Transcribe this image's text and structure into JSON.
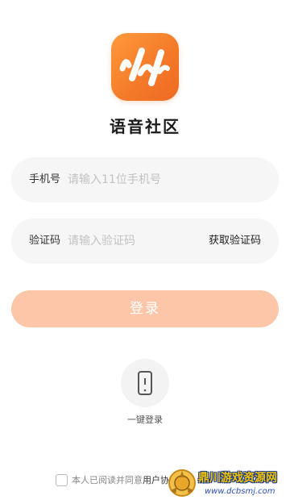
{
  "app": {
    "name": "语音社区",
    "logo_icon": "voice-wave-logo-icon"
  },
  "phone_field": {
    "label": "手机号",
    "placeholder": "请输入11位手机号",
    "value": ""
  },
  "code_field": {
    "label": "验证码",
    "placeholder": "请输入验证码",
    "value": "",
    "get_code_label": "获取验证码"
  },
  "login_button": {
    "label": "登录"
  },
  "one_key_login": {
    "label": "一键登录",
    "icon": "phone-icon"
  },
  "agreement": {
    "text": "本人已阅读并同意",
    "link_text": "用户协议"
  },
  "watermark": {
    "title": "鼎川游戏资源网",
    "url": "www.dcbsmj.com"
  },
  "colors": {
    "brand_orange": "#f47b2a",
    "login_button_disabled": "#fdc6a8",
    "field_background": "#f6f6f6",
    "placeholder_text": "#c2c2c2"
  }
}
